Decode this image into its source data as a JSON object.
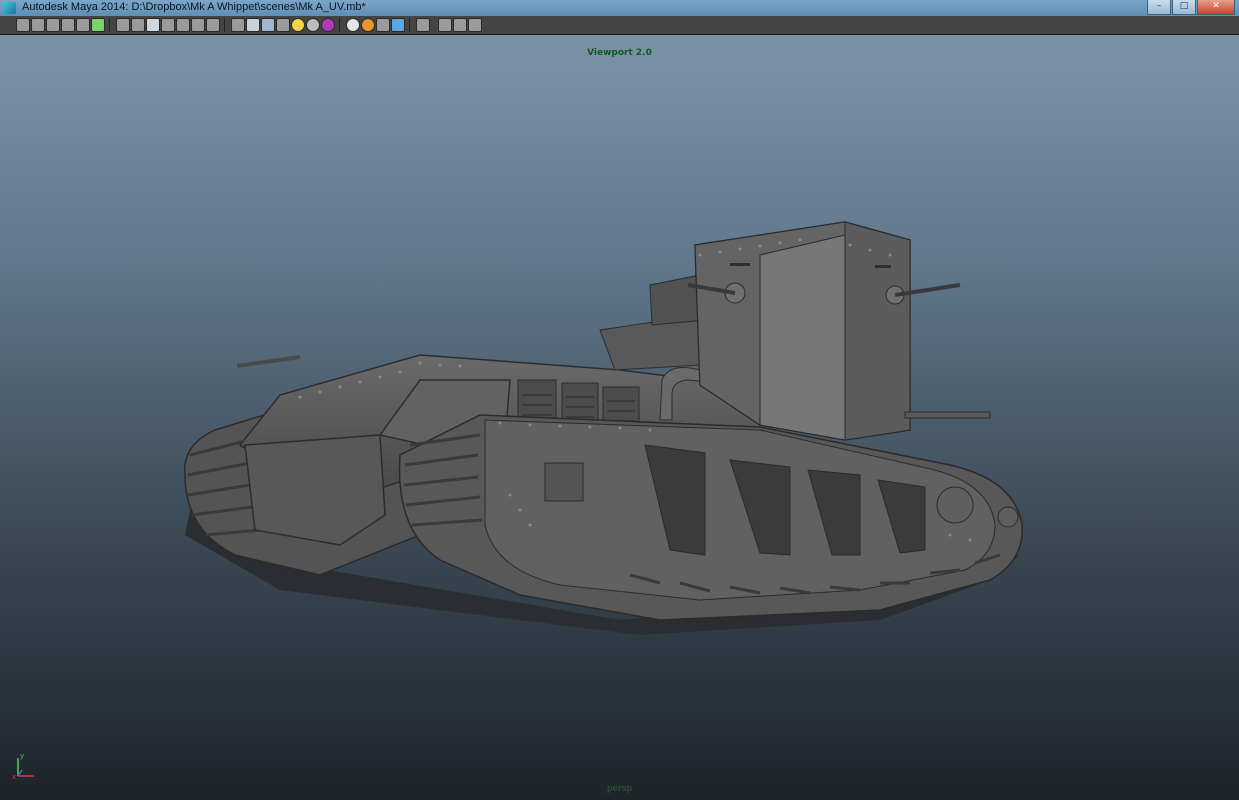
{
  "window": {
    "title": "Autodesk Maya 2014: D:\\Dropbox\\Mk A Whippet\\scenes\\Mk A_UV.mb*",
    "buttons": {
      "minimize": "–",
      "maximize": "□",
      "close": "✕"
    }
  },
  "toolbar": {
    "icons": [
      "select-camera-icon",
      "camera-attributes-icon",
      "bookmark-icon",
      "image-plane-icon",
      "2d-pan-zoom-icon",
      "grease-pencil-icon",
      "grid-icon",
      "film-gate-icon",
      "resolution-gate-icon",
      "gate-mask-icon",
      "field-chart-icon",
      "safe-action-icon",
      "safe-title-icon",
      "wireframe-icon",
      "smooth-shade-icon",
      "default-material-icon",
      "textured-icon",
      "use-all-lights-icon",
      "shadows-icon",
      "isolate-select-icon",
      "ambient-occlusion-icon",
      "motion-blur-icon",
      "anti-aliasing-icon",
      "depth-of-field-icon",
      "xray-icon",
      "xray-joints-icon",
      "xray-components-icon"
    ]
  },
  "viewport": {
    "renderer_label": "Viewport 2.0",
    "camera_label": "persp",
    "axis": {
      "y": "y",
      "x": "x"
    },
    "background_top": "#7b93a9",
    "background_bottom": "#1e2329"
  },
  "scene": {
    "model_name": "Mk A Whippet tank",
    "model_color": "#5a5a5a"
  }
}
